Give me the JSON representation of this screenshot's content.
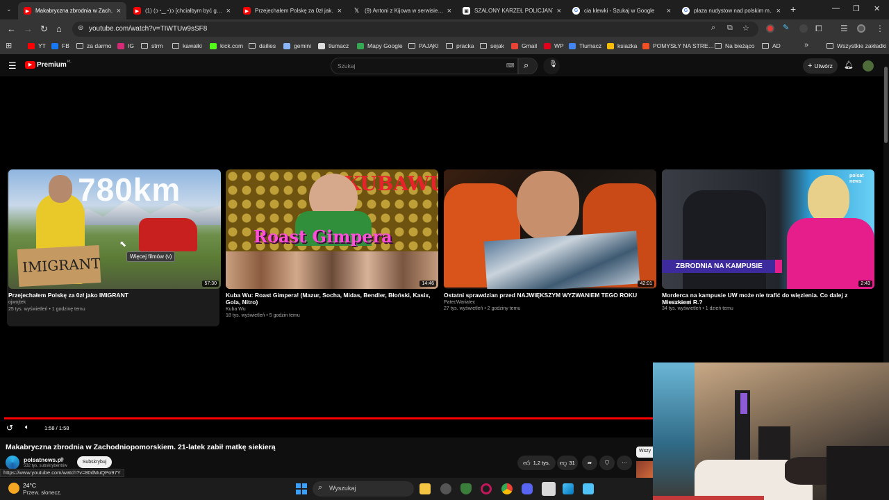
{
  "browser": {
    "tabs": [
      {
        "title": "Makabryczna zbrodnia w Zach…",
        "icon": "youtube-icon",
        "active": true
      },
      {
        "title": "(1) (ɔ◔‿◔)ɔ [chciałbym być g…",
        "icon": "youtube-icon",
        "active": false
      },
      {
        "title": "Przejechałem Polskę za 0zł jak…",
        "icon": "youtube-icon",
        "active": false
      },
      {
        "title": "(9) Antoni z Kijowa w serwisie…",
        "icon": "x-icon",
        "active": false
      },
      {
        "title": "SZALONY KARZEŁ POLICJANT…",
        "icon": "image-icon",
        "active": false
      },
      {
        "title": "cia klewki - Szukaj w Google",
        "icon": "google-icon",
        "active": false
      },
      {
        "title": "plaza nudystow nad polskim m…",
        "icon": "google-icon",
        "active": false
      }
    ],
    "new_tab": "+",
    "url": "youtube.com/watch?v=TIWTUw9sSF8"
  },
  "bookmarks": {
    "items": [
      {
        "label": "YT",
        "icon": "youtube-icon",
        "color": "#ff0000"
      },
      {
        "label": "FB",
        "icon": "facebook-icon",
        "color": "#1877f2"
      },
      {
        "label": "za darmo",
        "icon": "folder-icon",
        "color": ""
      },
      {
        "label": "IG",
        "icon": "instagram-icon",
        "color": "#d62976"
      },
      {
        "label": "strm",
        "icon": "folder-icon",
        "color": ""
      },
      {
        "label": "kawałki",
        "icon": "folder-icon",
        "color": ""
      },
      {
        "label": "kick.com",
        "icon": "kick-icon",
        "color": "#53fc18"
      },
      {
        "label": "dailies",
        "icon": "folder-icon",
        "color": ""
      },
      {
        "label": "gemini",
        "icon": "gemini-icon",
        "color": "#8ab4f8"
      },
      {
        "label": "tłumacz",
        "icon": "chatgpt-icon",
        "color": "#dddddd"
      },
      {
        "label": "Mapy Google",
        "icon": "maps-icon",
        "color": "#34a853"
      },
      {
        "label": "PAJĄKI",
        "icon": "folder-icon",
        "color": ""
      },
      {
        "label": "pracka",
        "icon": "folder-icon",
        "color": ""
      },
      {
        "label": "sejak",
        "icon": "folder-icon",
        "color": ""
      },
      {
        "label": "Gmail",
        "icon": "gmail-icon",
        "color": "#ea4335"
      },
      {
        "label": "WP",
        "icon": "wp-icon",
        "color": "#e2001a"
      },
      {
        "label": "Tłumacz",
        "icon": "translate-icon",
        "color": "#4285f4"
      },
      {
        "label": "ksiazka",
        "icon": "grid-icon",
        "color": "#fbbc05"
      },
      {
        "label": "POMYSŁY NA STRE…",
        "icon": "microsoft-icon",
        "color": "#f25022"
      },
      {
        "label": "Na bieżąco",
        "icon": "folder-icon",
        "color": ""
      },
      {
        "label": "AD",
        "icon": "folder-icon",
        "color": ""
      }
    ],
    "more": "»",
    "all_bookmarks": "Wszystkie zakładki"
  },
  "youtube": {
    "logo_text": "Premium",
    "logo_sup": "PL",
    "search_placeholder": "Szukaj",
    "create_label": "Utwórz",
    "brand_color": "#ff0000"
  },
  "endscreen": {
    "videos": [
      {
        "title": "Przejechałem Polskę za 0zł jako IMIGRANT",
        "channel": "ojwojtek",
        "meta": "25 tys. wyświetleń • 1 godzinę temu",
        "duration": "57:30",
        "overlay": "780km",
        "sign": "IMIGRANT"
      },
      {
        "title": "Kuba Wu: Roast Gimpera! (Mazur, Socha, Midas, Bendler, Błoński, Kasix, Gola, Nitro)",
        "channel": "Kuba Wu",
        "meta": "18 tys. wyświetleń • 5 godzin temu",
        "duration": "14:46",
        "overlay": "KUBAWU",
        "sign": "Roast Gimpera"
      },
      {
        "title": "Ostatni sprawdzian przed NAJWIĘKSZYM WYZWANIEM TEGO ROKU",
        "channel": "PatecWariatec",
        "meta": "27 tys. wyświetleń • 2 godziny temu",
        "duration": "42:01",
        "overlay": "",
        "sign": ""
      },
      {
        "title": "Morderca na kampusie UW może nie trafić do więzienia. Co dalej z Mieszkiem R.?",
        "channel": "polsatnews.pl",
        "meta": "34 tys. wyświetleń • 1 dzień temu",
        "duration": "2:43",
        "overlay": "ZBRODNIA NA KAMPUSIE",
        "sign": "polsat news"
      }
    ],
    "tooltip": "Więcej filmów (v)"
  },
  "player": {
    "time": "1:58 / 1:58",
    "progress": 1.0
  },
  "video": {
    "title": "Makabryczna zbrodnia w Zachodniopomorskiem. 21-latek zabił matkę siekierą",
    "channel": "polsatnews.pl",
    "subscribers": "532 tys. subskrybentów",
    "subscribe_label": "Subskrybuj",
    "likes": "1,2 tys.",
    "dislikes": "31",
    "side_chip": "Wszy"
  },
  "status_url": "https://www.youtube.com/watch?v=80dMuQPo97Y",
  "taskbar": {
    "temperature": "24°C",
    "weather": "Przew. słonecz.",
    "search_label": "Wyszukaj"
  }
}
